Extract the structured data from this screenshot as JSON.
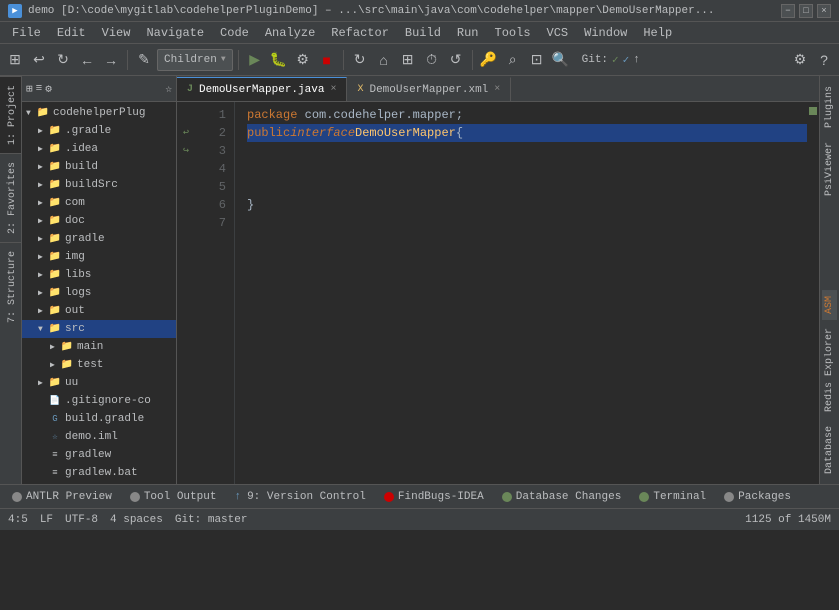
{
  "titleBar": {
    "icon": "▶",
    "text": "demo [D:\\code\\mygitlab\\codehelperPluginDemo] – ...\\src\\main\\java\\com\\codehelper\\mapper\\DemoUserMapper...",
    "minimize": "−",
    "maximize": "□",
    "close": "×"
  },
  "menuBar": {
    "items": [
      "File",
      "Edit",
      "View",
      "Navigate",
      "Code",
      "Analyze",
      "Refactor",
      "Build",
      "Run",
      "Tools",
      "VCS",
      "Window",
      "Help"
    ]
  },
  "toolbar": {
    "dropdown": "Children",
    "gitLabel": "Git:",
    "searchPlaceholder": ""
  },
  "projectPanel": {
    "title": "1: Project",
    "rootName": "codehelperPlug",
    "items": [
      {
        "level": 1,
        "type": "folder",
        "name": ".gradle",
        "expanded": false
      },
      {
        "level": 1,
        "type": "folder",
        "name": ".idea",
        "expanded": false
      },
      {
        "level": 1,
        "type": "folder",
        "name": "build",
        "expanded": false
      },
      {
        "level": 1,
        "type": "folder",
        "name": "buildSrc",
        "expanded": false
      },
      {
        "level": 1,
        "type": "folder",
        "name": "com",
        "expanded": false
      },
      {
        "level": 1,
        "type": "folder",
        "name": "doc",
        "expanded": false
      },
      {
        "level": 1,
        "type": "folder",
        "name": "gradle",
        "expanded": false
      },
      {
        "level": 1,
        "type": "folder",
        "name": "img",
        "expanded": false
      },
      {
        "level": 1,
        "type": "folder",
        "name": "libs",
        "expanded": false
      },
      {
        "level": 1,
        "type": "folder",
        "name": "logs",
        "expanded": false
      },
      {
        "level": 1,
        "type": "folder",
        "name": "out",
        "expanded": false
      },
      {
        "level": 1,
        "type": "folder",
        "name": "src",
        "expanded": true
      },
      {
        "level": 2,
        "type": "folder",
        "name": "main",
        "expanded": false
      },
      {
        "level": 2,
        "type": "folder",
        "name": "test",
        "expanded": false
      },
      {
        "level": 1,
        "type": "folder",
        "name": "uu",
        "expanded": false
      },
      {
        "level": 1,
        "type": "file",
        "name": ".gitignore-co",
        "fileType": "git"
      },
      {
        "level": 1,
        "type": "file",
        "name": "build.gradle",
        "fileType": "gradle"
      },
      {
        "level": 1,
        "type": "file",
        "name": "demo.iml",
        "fileType": "iml"
      },
      {
        "level": 1,
        "type": "file",
        "name": "gradlew",
        "fileType": "gradlew"
      },
      {
        "level": 1,
        "type": "file",
        "name": "gradlew.bat",
        "fileType": "bat"
      }
    ]
  },
  "editorTabs": [
    {
      "name": "DemoUserMapper.java",
      "type": "java",
      "active": true,
      "modified": false
    },
    {
      "name": "DemoUserMapper.xml",
      "type": "xml",
      "active": false,
      "modified": true
    }
  ],
  "codeLines": [
    {
      "num": 1,
      "content": "package com.codehelper.mapper;"
    },
    {
      "num": 2,
      "content": "public interface DemoUserMapper {",
      "highlighted": true
    },
    {
      "num": 3,
      "content": ""
    },
    {
      "num": 4,
      "content": ""
    },
    {
      "num": 5,
      "content": ""
    },
    {
      "num": 6,
      "content": "}"
    },
    {
      "num": 7,
      "content": ""
    }
  ],
  "rightPanels": [
    {
      "name": "Plugins"
    },
    {
      "name": "PsiViewer"
    },
    {
      "name": "ASM"
    },
    {
      "name": "Redis Explorer"
    },
    {
      "name": "Database"
    }
  ],
  "bottomTabs": [
    {
      "name": "ANTLR Preview",
      "dotColor": "gray"
    },
    {
      "name": "Tool Output",
      "dotColor": "gray"
    },
    {
      "name": "9: Version Control",
      "dotColor": "blue",
      "prefix": "↑"
    },
    {
      "name": "FindBugs-IDEA",
      "dotColor": "red"
    },
    {
      "name": "Database Changes",
      "dotColor": "green"
    },
    {
      "name": "Terminal",
      "dotColor": "green"
    },
    {
      "name": "Packages",
      "dotColor": "gray"
    }
  ],
  "statusBar": {
    "position": "4:5",
    "lineEnding": "LF",
    "encoding": "UTF-8",
    "indent": "4 spaces",
    "git": "Git: master",
    "memory": "1125 of 1450M"
  },
  "leftSidebarTabs": [
    {
      "name": "1: Project",
      "active": true
    },
    {
      "name": "2: Favorites"
    },
    {
      "name": "7: Structure"
    }
  ]
}
